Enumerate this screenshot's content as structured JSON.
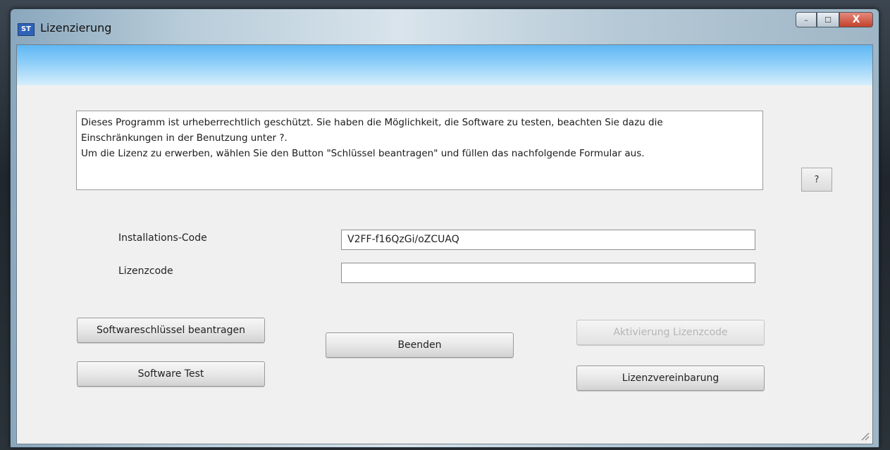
{
  "window": {
    "title": "Lizenzierung",
    "app_icon_text": "ST",
    "controls": {
      "minimize": "–",
      "maximize": "☐",
      "close": "X"
    }
  },
  "info": {
    "lines": [
      "Dieses Programm ist urheberrechtlich geschützt. Sie haben die Möglichkeit, die Software zu testen, beachten Sie dazu die",
      "Einschränkungen in der Benutzung unter ?.",
      "Um die Lizenz zu erwerben, wählen Sie den Button \"Schlüssel beantragen\" und füllen das nachfolgende Formular aus."
    ]
  },
  "help_button": "?",
  "form": {
    "installation_code_label": "Installations-Code",
    "installation_code_value": "V2FF-f16QzGi/oZCUAQ",
    "license_code_label": "Lizenzcode",
    "license_code_value": ""
  },
  "buttons": {
    "request_key": "Softwareschlüssel beantragen",
    "software_test": "Software Test",
    "exit": "Beenden",
    "activate_code": "Aktivierung Lizenzcode",
    "license_agreement": "Lizenzvereinbarung"
  },
  "colors": {
    "header_band_top": "#5fb7f4",
    "close_button": "#c3412c",
    "disabled_text": "#b5b5b5"
  }
}
